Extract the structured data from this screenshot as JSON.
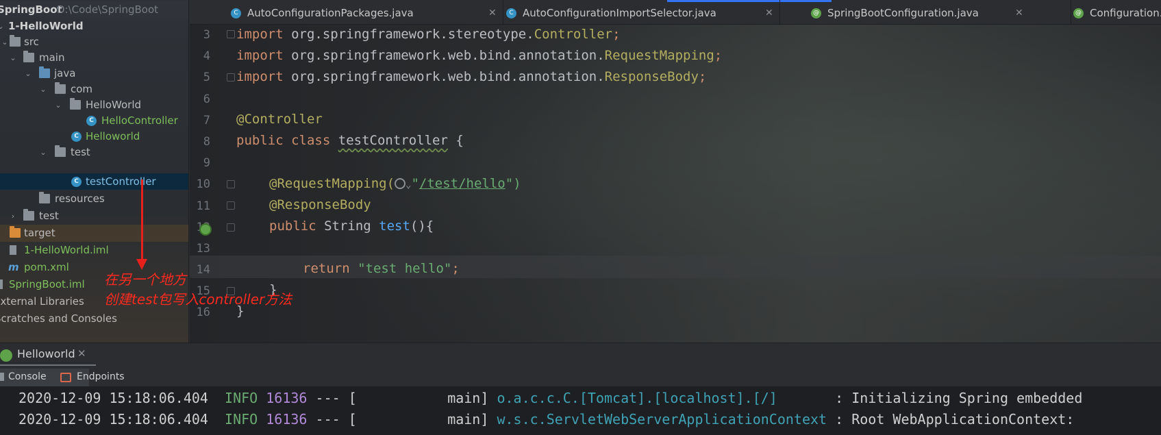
{
  "project": {
    "root_name": "SpringBoot",
    "root_path": "D:\\Code\\SpringBoot",
    "items": [
      {
        "label": "1-HelloWorld"
      },
      {
        "label": "src"
      },
      {
        "label": "main"
      },
      {
        "label": "java"
      },
      {
        "label": "com"
      },
      {
        "label": "HelloWorld"
      },
      {
        "label": "HelloController"
      },
      {
        "label": "Helloworld"
      },
      {
        "label": "test"
      },
      {
        "label": "testController"
      },
      {
        "label": "resources"
      },
      {
        "label": "test"
      },
      {
        "label": "target"
      },
      {
        "label": "1-HelloWorld.iml"
      },
      {
        "label": "pom.xml"
      },
      {
        "label": "SpringBoot.iml"
      },
      {
        "label": "External Libraries"
      },
      {
        "label": "Scratches and Consoles"
      }
    ]
  },
  "tabs": [
    {
      "label": "AutoConfigurationPackages.java",
      "icon": "class-icon"
    },
    {
      "label": "AutoConfigurationImportSelector.java",
      "icon": "class-icon"
    },
    {
      "label": "SpringBootConfiguration.java",
      "icon": "spring-annotation-icon"
    },
    {
      "label": "Configuration.",
      "icon": "spring-annotation-icon"
    }
  ],
  "editor": {
    "line_numbers": [
      "3",
      "4",
      "5",
      "6",
      "7",
      "8",
      "9",
      "10",
      "11",
      "12",
      "13",
      "14",
      "15",
      "16"
    ],
    "l3": {
      "kw": "import",
      "pkg": " org.springframework.stereotype.",
      "cls": "Controller",
      "end": ";"
    },
    "l4": {
      "kw": "import",
      "pkg": " org.springframework.web.bind.annotation.",
      "cls": "RequestMapping",
      "end": ";"
    },
    "l5": {
      "kw": "import",
      "pkg": " org.springframework.web.bind.annotation.",
      "cls": "ResponseBody",
      "end": ";"
    },
    "l7": {
      "ann": "@Controller"
    },
    "l8": {
      "kw1": "public",
      "kw2": "class",
      "name": "testController",
      "brace": " {"
    },
    "l10": {
      "ann": "@RequestMapping(",
      "url": "/test/hello",
      "q1": "\"",
      "q2": "\")"
    },
    "l11": {
      "ann": "@ResponseBody"
    },
    "l12": {
      "kw": "public",
      "type": " String ",
      "fn": "test",
      "rest": "(){"
    },
    "l14": {
      "kw": "return",
      "str": " \"test hello\"",
      "end": ";"
    },
    "l15": {
      "brace": "}"
    },
    "l16": {
      "brace": "}"
    }
  },
  "annotation": {
    "line1": "在另一个地方",
    "line2": "创建test包写入controller方法",
    "color": "#ff2a1f"
  },
  "run": {
    "tab_label": "Helloworld",
    "console_label": "Console",
    "endpoints_label": "Endpoints",
    "logs": [
      {
        "time": "2020-12-09 15:18:06.404",
        "level": "INFO",
        "pid": "16136",
        "sep": " --- [",
        "thread": "main]",
        "logger": "o.a.c.c.C.[Tomcat].[localhost].[/]      ",
        "msg": " : Initializing Spring embedded"
      },
      {
        "time": "2020-12-09 15:18:06.404",
        "level": "INFO",
        "pid": "16136",
        "sep": " --- [",
        "thread": "main]",
        "logger": "w.s.c.ServletWebServerApplicationContext",
        "msg": " : Root WebApplicationContext:"
      }
    ]
  }
}
